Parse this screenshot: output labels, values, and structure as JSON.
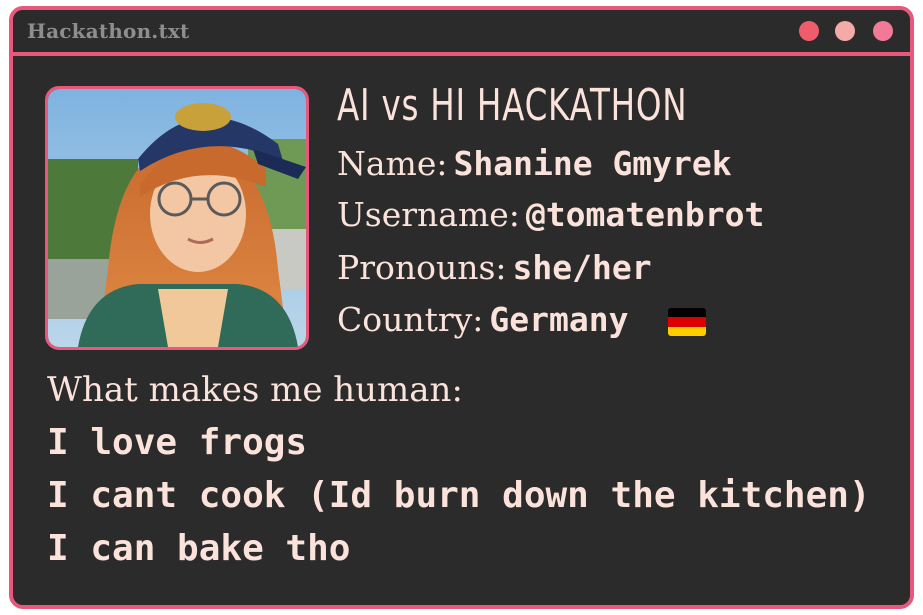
{
  "window": {
    "title": "Hackathon.txt",
    "border_color": "#e8577c",
    "background_color": "#2b2b2b",
    "controls": [
      {
        "name": "close",
        "color": "#ef5d6d"
      },
      {
        "name": "minimize",
        "color": "#f4aaa6"
      },
      {
        "name": "maximize",
        "color": "#f27a98"
      }
    ]
  },
  "profile": {
    "headline": "AI vs HI HACKATHON",
    "name_label": "Name:",
    "name_value": "Shanine Gmyrek",
    "username_label": "Username:",
    "username_value": "@tomatenbrot",
    "pronouns_label": "Pronouns:",
    "pronouns_value": "she/her",
    "country_label": "Country:",
    "country_value": "Germany",
    "country_flag_icon": "germany-flag-icon",
    "photo_icon": "profile-photo"
  },
  "human": {
    "heading": "What makes me human:",
    "items": [
      "I love frogs",
      "I cant cook (Id burn down the kitchen)",
      "I can bake tho"
    ]
  },
  "colors": {
    "text": "#fbe3dc",
    "title_text": "#8e8e8e",
    "flag": [
      "#000000",
      "#dd0000",
      "#ffce00"
    ]
  }
}
